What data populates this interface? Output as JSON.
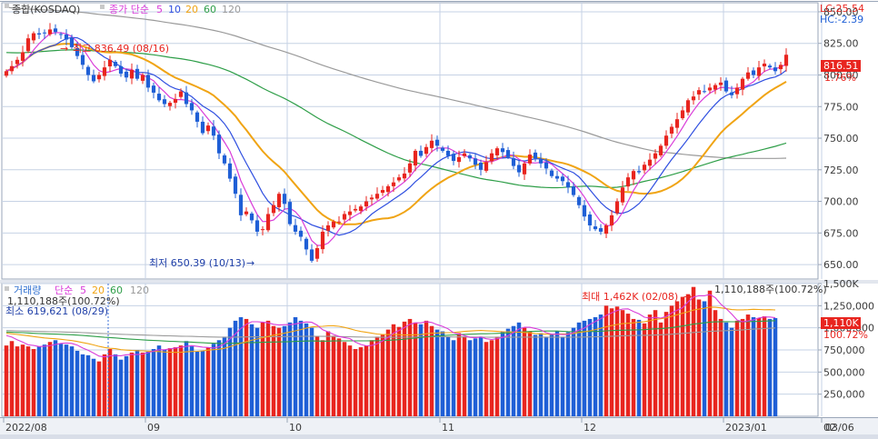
{
  "colors": {
    "up": "#e8251f",
    "down": "#1f5fd6",
    "ma5": "#d93cd9",
    "ma10": "#2f4fe0",
    "ma20": "#f0a414",
    "ma60": "#2e9e48",
    "ma120": "#9a9a9a",
    "grid": "#c6d2e4",
    "axis_text": "#3a3a3a",
    "panel_border": "#9aa6b8"
  },
  "price_panel": {
    "title": "종합(KOSDAQ)",
    "legend_prefix": "종가 단순",
    "legend_periods": [
      "5",
      "10",
      "20",
      "60",
      "120"
    ],
    "lc_label": "LC:25.54",
    "hc_label": "HC:-2.39",
    "current_price_label": "816.51",
    "current_change_label": "1.76%",
    "high_annotation": "최고 836.49 (08/16)",
    "low_annotation": "최저 650.39 (10/13)",
    "arrow_glyph": "→",
    "y_ticks": [
      "850.00",
      "825.00",
      "800.00",
      "775.00",
      "750.00",
      "725.00",
      "700.00",
      "675.00",
      "650.00"
    ]
  },
  "volume_panel": {
    "title": "거래량",
    "legend_prefix": "단순",
    "legend_periods": [
      "5",
      "20",
      "60",
      "120"
    ],
    "left_value_label": "1,110,188주(100.72%)",
    "right_value_label": "1,110,188주(100.72%)",
    "low_annotation": "최소 619,621 (08/29)",
    "high_annotation": "최대 1,462K (02/08)",
    "current_volume_label": "1,110K",
    "current_pct_label": "100.72%",
    "y_ticks": [
      "1,500K",
      "1,250,000",
      "1,000,000",
      "750,000",
      "500,000",
      "250,000"
    ]
  },
  "x_axis": {
    "labels": [
      "2022/08",
      "09",
      "10",
      "11",
      "12",
      "2023/01",
      "02",
      "03"
    ],
    "right_label": "03/06"
  },
  "chart_data": {
    "type": "candlestick",
    "title": "종합(KOSDAQ)",
    "x_range": [
      "2022/08",
      "2023/03/06"
    ],
    "price_ylim": [
      640,
      855
    ],
    "volume_ylim": [
      0,
      1500000
    ],
    "grid": true,
    "moving_average_periods": [
      5,
      10,
      20,
      60,
      120
    ],
    "last_close": 816.51,
    "last_change_pct": 1.76,
    "period_high": {
      "value": 836.49,
      "date": "08/16"
    },
    "period_low": {
      "value": 650.39,
      "date": "10/13"
    },
    "volume_high": {
      "value": 1462000,
      "date": "02/08"
    },
    "volume_low": {
      "value": 619621,
      "date": "08/29"
    },
    "last_volume": 1110188,
    "last_volume_pct": 100.72,
    "closes": [
      803,
      807,
      812,
      818,
      829,
      833,
      832,
      833,
      836,
      834,
      832,
      828,
      822,
      815,
      808,
      800,
      795,
      800,
      806,
      812,
      807,
      801,
      798,
      804,
      797,
      800,
      790,
      786,
      780,
      777,
      778,
      781,
      787,
      777,
      772,
      763,
      754,
      760,
      752,
      738,
      730,
      718,
      706,
      689,
      692,
      685,
      676,
      678,
      690,
      697,
      706,
      698,
      682,
      676,
      672,
      662,
      653,
      663,
      676,
      681,
      684,
      684,
      690,
      692,
      694,
      696,
      700,
      703,
      706,
      709,
      712,
      715,
      719,
      722,
      730,
      740,
      736,
      743,
      748,
      744,
      740,
      736,
      732,
      735,
      738,
      734,
      729,
      725,
      731,
      738,
      742,
      739,
      735,
      728,
      723,
      730,
      737,
      734,
      730,
      726,
      720,
      718,
      716,
      711,
      705,
      697,
      688,
      681,
      678,
      676,
      681,
      689,
      700,
      711,
      719,
      724,
      723,
      729,
      733,
      738,
      744,
      752,
      759,
      765,
      772,
      780,
      783,
      788,
      787,
      790,
      792,
      794,
      787,
      784,
      790,
      797,
      802,
      800,
      806,
      809,
      806,
      803,
      808,
      816
    ],
    "volumes": [
      800,
      850,
      790,
      810,
      790,
      760,
      790,
      810,
      840,
      860,
      820,
      810,
      790,
      740,
      700,
      690,
      650,
      620,
      700,
      760,
      700,
      640,
      680,
      720,
      750,
      720,
      730,
      760,
      800,
      750,
      770,
      780,
      800,
      850,
      790,
      730,
      740,
      780,
      820,
      860,
      900,
      1000,
      1080,
      1120,
      1100,
      1040,
      1000,
      1060,
      1080,
      1020,
      1000,
      1020,
      1060,
      1120,
      1080,
      1050,
      1000,
      900,
      860,
      960,
      910,
      880,
      840,
      800,
      760,
      780,
      800,
      860,
      900,
      920,
      980,
      1040,
      1010,
      1070,
      1100,
      1060,
      1040,
      1080,
      1020,
      980,
      960,
      900,
      860,
      940,
      900,
      860,
      880,
      900,
      840,
      860,
      900,
      960,
      990,
      1020,
      1060,
      1000,
      960,
      920,
      940,
      900,
      920,
      960,
      900,
      950,
      1000,
      1060,
      1080,
      1100,
      1120,
      1150,
      1250,
      1220,
      1240,
      1200,
      1160,
      1100,
      1090,
      1050,
      1150,
      1200,
      1060,
      1180,
      1250,
      1300,
      1350,
      1380,
      1462,
      1320,
      1300,
      1420,
      1200,
      1100,
      1060,
      1000,
      1080,
      1100,
      1150,
      1120,
      1110,
      1130,
      1100,
      1110
    ]
  }
}
